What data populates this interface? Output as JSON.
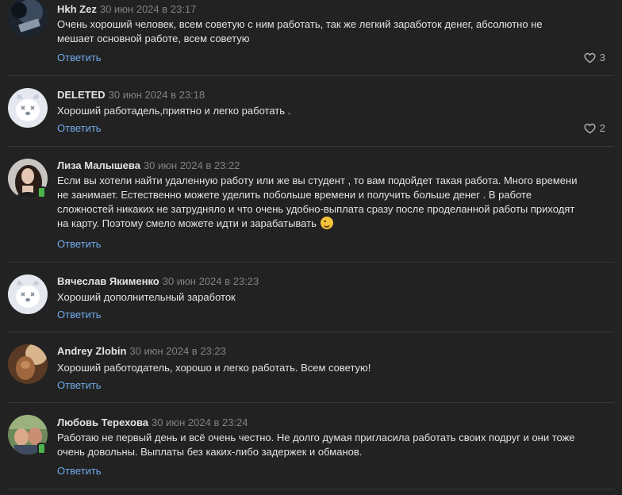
{
  "comments": [
    {
      "author": "Hkh Zez",
      "date": "30 июн 2024 в 23:17",
      "lines": [
        "Очень хороший человек, всем советую с ним работать, так же легкий заработок денег, абсолютно не",
        "мешает основной работе, всем советую"
      ],
      "reply_label": "Ответить",
      "likes": "3",
      "avatar": "photo-icon"
    },
    {
      "author": "DELETED",
      "date": "30 июн 2024 в 23:18",
      "lines": [
        "Хороший работадель,приятно и легко работать ."
      ],
      "reply_label": "Ответить",
      "likes": "2",
      "avatar": "deleted-dog-icon"
    },
    {
      "author": "Лиза Малышева",
      "date": "30 июн 2024 в 23:22",
      "lines": [
        "Если вы хотели найти удаленную работу или же вы студент , то вам подойдет такая работа. Много времени",
        "не занимает. Естественно можете уделить побольше времени и получить больше денег . В работе",
        "сложностей никаких не затрудняло и что очень удобно-выплата сразу после проделанной работы приходят",
        "на карту. Поэтому смело можете идти и зарабатывать"
      ],
      "emoji": "wink-emoji-icon",
      "reply_label": "Ответить",
      "avatar": "photo-icon",
      "online": "mobile-online-icon"
    },
    {
      "author": "Вячеслав Якименко",
      "date": "30 июн 2024 в 23:23",
      "lines": [
        "Хороший дополнительный заработок"
      ],
      "reply_label": "Ответить",
      "avatar": "deleted-dog-icon"
    },
    {
      "author": "Andrey Zlobin",
      "date": "30 июн 2024 в 23:23",
      "lines": [
        "Хороший работодатель, хорошо и легко работать. Всем советую!"
      ],
      "reply_label": "Ответить",
      "avatar": "photo-icon"
    },
    {
      "author": "Любовь Терехова",
      "date": "30 июн 2024 в 23:24",
      "lines": [
        "Работаю не первый день и всё очень честно. Не долго думая пригласила работать своих подруг и они тоже",
        "очень довольны. Выплаты без каких-либо задержек и обманов."
      ],
      "reply_label": "Ответить",
      "avatar": "photo-icon",
      "online": "mobile-online-icon"
    }
  ],
  "colors": {
    "background": "#222222",
    "text": "#e1e3e6",
    "secondary": "#828282",
    "link": "#71aaeb",
    "divider": "#363738",
    "online": "#4bb34b"
  }
}
